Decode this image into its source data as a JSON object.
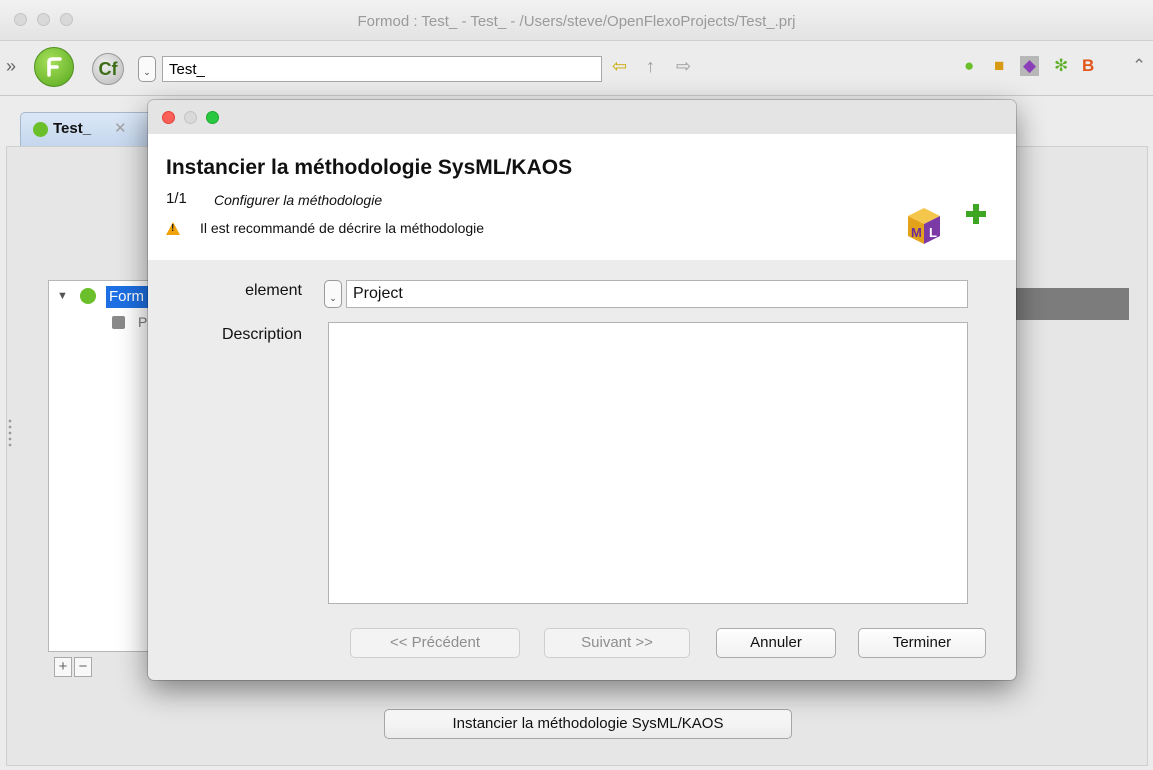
{
  "window": {
    "title": "Formod : Test_ - Test_ - /Users/steve/OpenFlexoProjects/Test_.prj"
  },
  "toolbar": {
    "project_value": "Test_",
    "back_icon": "back-arrow-icon",
    "up_icon": "up-arrow-icon",
    "forward_icon": "forward-arrow-icon"
  },
  "tabs": [
    {
      "label": "Test_"
    }
  ],
  "tree": {
    "root_label": "Form",
    "child_label": "P"
  },
  "main_action_button": "Instancier la méthodologie SysML/KAOS",
  "dialog": {
    "title": "Instancier la méthodologie SysML/KAOS",
    "step": "1/1",
    "step_description": "Configurer la méthodologie",
    "warning": "Il est recommandé de décrire la méthodologie",
    "element_label": "element",
    "element_value": "Project",
    "description_label": "Description",
    "description_value": "",
    "buttons": {
      "previous": "<< Précédent",
      "next": "Suivant >>",
      "cancel": "Annuler",
      "finish": "Terminer"
    }
  },
  "colors": {
    "selection": "#1d6fe3",
    "accent_green": "#6abf2b",
    "close_red": "#fc5f57",
    "minimize_gray": "#d9d9d9",
    "zoom_green": "#2ac840"
  }
}
